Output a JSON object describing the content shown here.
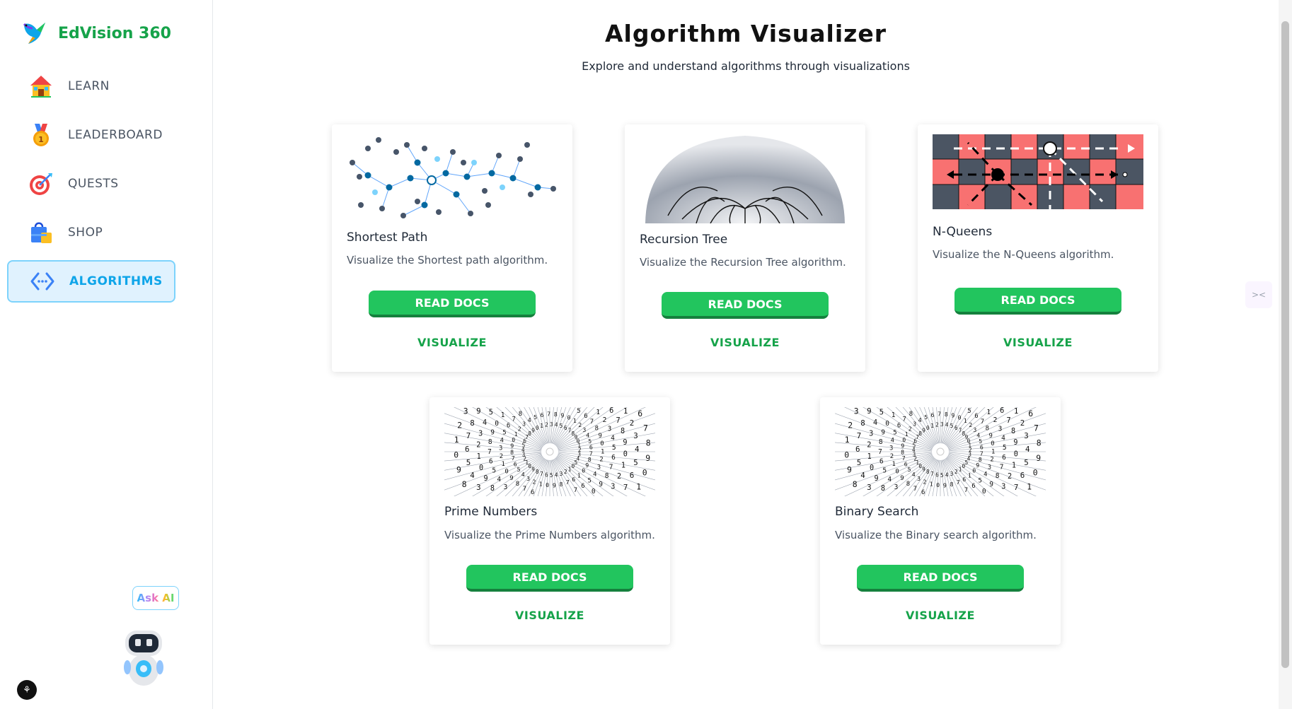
{
  "app": {
    "name": "EdVision 360"
  },
  "sidebar": {
    "items": [
      {
        "label": "LEARN",
        "icon": "house-icon"
      },
      {
        "label": "LEADERBOARD",
        "icon": "medal-icon"
      },
      {
        "label": "QUESTS",
        "icon": "target-icon"
      },
      {
        "label": "SHOP",
        "icon": "shopping-bag-icon"
      },
      {
        "label": "ALGORITHMS",
        "icon": "code-brackets-icon",
        "active": true
      }
    ],
    "ask_ai": "Ask AI"
  },
  "page": {
    "title": "Algorithm Visualizer",
    "subtitle": "Explore and understand algorithms through visualizations"
  },
  "cards": [
    {
      "title": "Shortest Path",
      "description": "Visualize the Shortest path algorithm.",
      "read_docs": "READ DOCS",
      "visualize": "VISUALIZE"
    },
    {
      "title": "Recursion Tree",
      "description": "Visualize the Recursion Tree algorithm.",
      "read_docs": "READ DOCS",
      "visualize": "VISUALIZE"
    },
    {
      "title": "N-Queens",
      "description": "Visualize the N-Queens algorithm.",
      "read_docs": "READ DOCS",
      "visualize": "VISUALIZE"
    },
    {
      "title": "Prime Numbers",
      "description": "Visualize the Prime Numbers algorithm.",
      "read_docs": "READ DOCS",
      "visualize": "VISUALIZE"
    },
    {
      "title": "Binary Search",
      "description": "Visualize the Binary search algorithm.",
      "read_docs": "READ DOCS",
      "visualize": "VISUALIZE"
    }
  ],
  "colors": {
    "brand": "#16a34a",
    "button": "#22c55e",
    "active_nav_bg": "#e0f2fe",
    "active_nav_text": "#0ea5e9"
  }
}
